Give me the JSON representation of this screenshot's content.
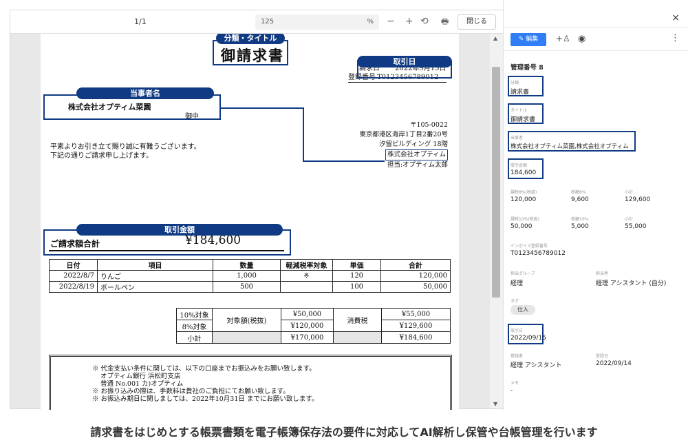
{
  "viewer": {
    "page_indicator": "1/1",
    "zoom_value": "125",
    "zoom_unit": "%",
    "zoom_out": "−",
    "zoom_in": "+",
    "rotate": "⟲",
    "print": "🖶",
    "close_label": "閉じる"
  },
  "document": {
    "tags": {
      "category_title": "分類・タイトル",
      "transaction_date": "取引日",
      "party": "当事者名",
      "amount": "取引金額"
    },
    "title": "御請求書",
    "date_label": "請求日",
    "date_value": "2022年9月15日",
    "reg_label": "登録番号",
    "reg_value": "T0123456789012",
    "recipient": "株式会社オプティム菜園",
    "recipient_suffix": "御中",
    "sender_postal": "〒105-0022",
    "sender_address1": "東京都港区海岸1丁目2番20号",
    "sender_address2": "汐留ビルディング 18階",
    "sender_company": "株式会社オプティム",
    "sender_person": "担当:オプティム太郎",
    "greeting1": "平素よりお引き立て賜り誠に有難うございます。",
    "greeting2": "下記の通りご請求申し上げます。",
    "total_label": "ご請求額合計",
    "total_value": "¥184,600",
    "items_headers": [
      "日付",
      "項目",
      "数量",
      "軽減税率対象",
      "単価",
      "合計"
    ],
    "items": [
      {
        "date": "2022/8/7",
        "item": "りんご",
        "qty": "1,000",
        "reduced": "※",
        "unit": "120",
        "total": "120,000"
      },
      {
        "date": "2022/8/19",
        "item": "ボールペン",
        "qty": "500",
        "reduced": "",
        "unit": "100",
        "total": "50,000"
      }
    ],
    "tax": {
      "row1_label": "10%対象",
      "row2_label": "8%対象",
      "row3_label": "小計",
      "base_label": "対象額(税抜)",
      "base1": "¥50,000",
      "base2": "¥120,000",
      "base3": "¥170,000",
      "tax_label": "消費税",
      "incl1": "¥55,000",
      "incl2": "¥129,600",
      "incl3": "¥184,600"
    },
    "notes": [
      "※ 代金支払い条件に関しては、以下の口座までお振込みをお願い致します。",
      "オプティム銀行 浜松町支店",
      "普通 No.001 カ)オプティム",
      "※ お振り込みの際は、手数料は貴社のご負担にてお願い致します。",
      "※ お振込み期日に関しましては、2022年10月31日 までにお願い致します。"
    ]
  },
  "panel": {
    "close": "×",
    "edit_label": "編集",
    "more": "⋮",
    "management_no": "管理番号 8",
    "fields": {
      "category_label": "分類",
      "category_value": "請求書",
      "title_label": "タイトル",
      "title_value": "御請求書",
      "party_label": "当事者",
      "party_value": "株式会社オプティム菜園,株式会社オプティム",
      "amount_label": "取引金額",
      "amount_value": "184,600",
      "tax8_base_label": "課税8%(税抜)",
      "tax8_base_value": "120,000",
      "tax8_label": "税額8%",
      "tax8_value": "9,600",
      "sub1_label": "小計",
      "sub1_value": "129,600",
      "tax10_base_label": "課税10%(税抜)",
      "tax10_base_value": "50,000",
      "tax10_label": "税額10%",
      "tax10_value": "5,000",
      "sub2_label": "小計",
      "sub2_value": "55,000",
      "invoice_label": "インボイス登録番号",
      "invoice_value": "T0123456789012",
      "group_label": "担当グループ",
      "group_value": "経理",
      "owner_label": "担当者",
      "owner_value": "経理 アシスタント (自分)",
      "tag_label": "タグ",
      "tag_value": "仕入",
      "date_label": "取引日",
      "date_value": "2022/09/15",
      "registrant_label": "登録者",
      "registrant_value": "経理 アシスタント",
      "reg_date_label": "登録日",
      "reg_date_value": "2022/09/14",
      "memo_label": "メモ",
      "memo_value": "-"
    }
  },
  "caption": "請求書をはじめとする帳票書類を電子帳簿保存法の要件に対応してAI解析し保管や台帳管理を行います",
  "colors": {
    "highlight": "#103a83",
    "edit_button": "#2f7ef6"
  }
}
